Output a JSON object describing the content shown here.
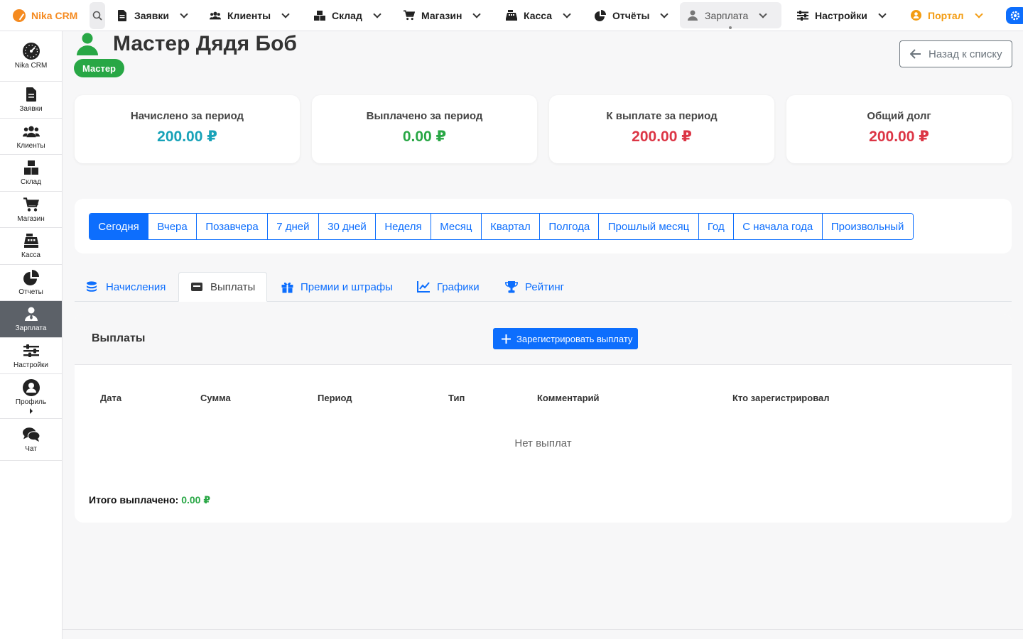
{
  "brand": {
    "name": "Nika CRM",
    "color": "#f58a1f"
  },
  "topnav": {
    "items": [
      {
        "label": "Заявки",
        "icon": "file-icon"
      },
      {
        "label": "Клиенты",
        "icon": "users-icon"
      },
      {
        "label": "Склад",
        "icon": "boxes-icon"
      },
      {
        "label": "Магазин",
        "icon": "cart-icon"
      },
      {
        "label": "Касса",
        "icon": "cash-register-icon"
      },
      {
        "label": "Отчёты",
        "icon": "pie-chart-icon"
      },
      {
        "label": "Зарплата",
        "icon": "user-tie-icon",
        "active": true
      },
      {
        "label": "Настройки",
        "icon": "sliders-icon"
      },
      {
        "label": "Портал",
        "icon": "portal-icon"
      }
    ]
  },
  "sidebar": {
    "items": [
      {
        "label": "Nika CRM",
        "icon": "dashboard-icon"
      },
      {
        "label": "Заявки",
        "icon": "file-icon"
      },
      {
        "label": "Клиенты",
        "icon": "users-icon"
      },
      {
        "label": "Склад",
        "icon": "boxes-icon"
      },
      {
        "label": "Магазин",
        "icon": "cart-icon"
      },
      {
        "label": "Касса",
        "icon": "cash-register-icon"
      },
      {
        "label": "Отчеты",
        "icon": "pie-chart-icon"
      },
      {
        "label": "Зарплата",
        "icon": "user-tie-icon",
        "active": true
      },
      {
        "label": "Настройки",
        "icon": "sliders-icon"
      },
      {
        "label": "Профиль",
        "icon": "user-circle-icon"
      },
      {
        "label": "Чат",
        "icon": "comments-icon"
      }
    ]
  },
  "header": {
    "title": "Мастер Дядя Боб",
    "role_badge": "Мастер",
    "back_button": "Назад к списку"
  },
  "stats": [
    {
      "label": "Начислено за период",
      "value": "200.00 ₽",
      "color": "#17a2b8"
    },
    {
      "label": "Выплачено за период",
      "value": "0.00 ₽",
      "color": "#28a745"
    },
    {
      "label": "К выплате за период",
      "value": "200.00 ₽",
      "color": "#dc3545"
    },
    {
      "label": "Общий долг",
      "value": "200.00 ₽",
      "color": "#dc3545"
    }
  ],
  "periods": {
    "selected": "Сегодня",
    "options": [
      "Сегодня",
      "Вчера",
      "Позавчера",
      "7 дней",
      "30 дней",
      "Неделя",
      "Месяц",
      "Квартал",
      "Полгода",
      "Прошлый месяц",
      "Год",
      "С начала года",
      "Произвольный"
    ]
  },
  "tabs": [
    {
      "label": "Начисления",
      "icon": "coins-icon"
    },
    {
      "label": "Выплаты",
      "icon": "money-bill-icon",
      "active": true
    },
    {
      "label": "Премии и штрафы",
      "icon": "gift-icon"
    },
    {
      "label": "Графики",
      "icon": "chart-line-icon"
    },
    {
      "label": "Рейтинг",
      "icon": "trophy-icon"
    }
  ],
  "payments": {
    "title": "Выплаты",
    "register_button": "Зарегистрировать выплату",
    "columns": [
      "Дата",
      "Сумма",
      "Период",
      "Тип",
      "Комментарий",
      "Кто зарегистрировал"
    ],
    "empty_message": "Нет выплат",
    "total_label": "Итого выплачено:",
    "total_value": "0.00 ₽"
  }
}
